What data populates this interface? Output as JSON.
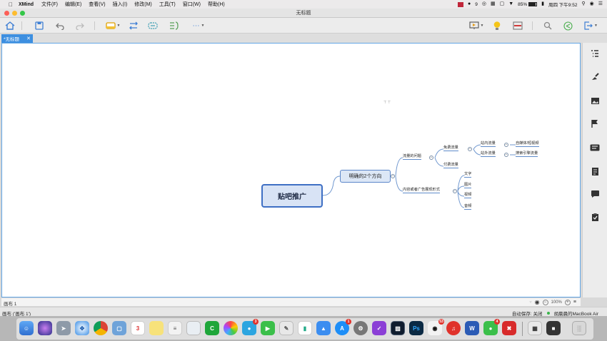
{
  "menubar": {
    "app_name": "XMind",
    "items": [
      "文件(F)",
      "编辑(E)",
      "查看(V)",
      "插入(I)",
      "修改(M)",
      "工具(T)",
      "窗口(W)",
      "帮助(H)"
    ],
    "status": {
      "wechat_count": "9",
      "battery": "85%",
      "clock": "周四 下午9:52"
    }
  },
  "window": {
    "title": "无标题"
  },
  "toolbar": {
    "icons": [
      "home-icon",
      "save-icon",
      "undo-icon",
      "redo-icon",
      "topic-icon",
      "relationship-icon",
      "boundary-icon",
      "summary-icon",
      "more-icon",
      "presentation-icon",
      "idea-icon",
      "layout-icon",
      "search-icon",
      "share-icon",
      "export-icon"
    ]
  },
  "tab": {
    "label": "*无标题"
  },
  "mindmap": {
    "root": "贴吧推广",
    "main_topic": "明确的2个方向",
    "branch1": {
      "label": "流量的问题",
      "free": "免费流量",
      "free_in": "站内流量",
      "free_in_child": "自媒体/短视频",
      "free_out": "站外流量",
      "free_out_child": "搜索引擎流量",
      "paid": "付费流量"
    },
    "branch2": {
      "label": "内容或者广告展现形式",
      "children": [
        "文字",
        "图片",
        "视频",
        "音频"
      ]
    }
  },
  "sheetbar": {
    "sheet_name": "画布 1",
    "zoom": "100%"
  },
  "statusbar": {
    "left": "画布 ('画布 1')",
    "autosave": "自动保存: 关闭",
    "device": "胡晨晨的MacBook Air"
  },
  "dock": {
    "calendar_day": "3",
    "badges": {
      "qq": "53",
      "app_store": "1",
      "wechat": "4"
    }
  },
  "colors": {
    "accent": "#3d8fe0",
    "node_border": "#3e6fc4",
    "node_fill": "#d8e3f5",
    "line": "#5f8bc9"
  }
}
